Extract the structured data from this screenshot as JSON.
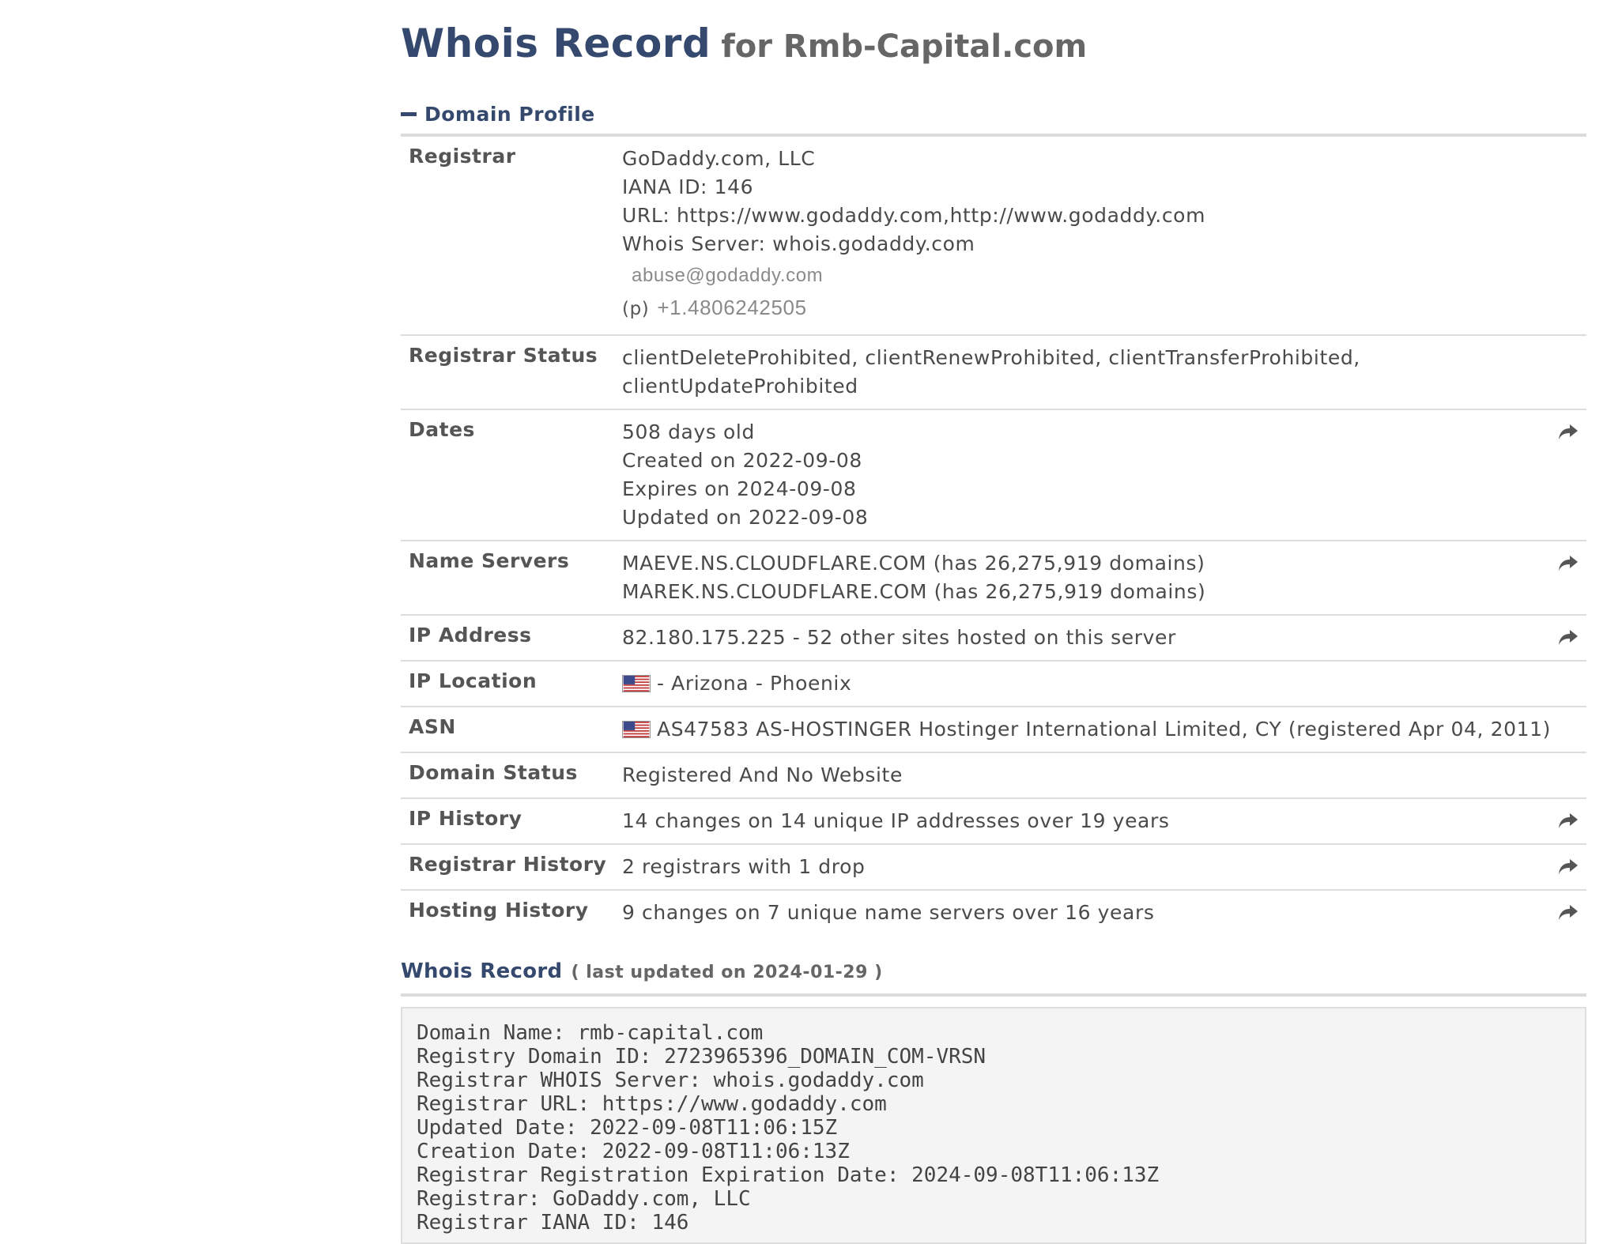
{
  "header": {
    "title_main": "Whois Record",
    "title_sub": "for Rmb-Capital.com"
  },
  "domain_profile": {
    "section_label": "Domain Profile",
    "registrar": {
      "label": "Registrar",
      "name": "GoDaddy.com, LLC",
      "iana": "IANA ID: 146",
      "url": "URL: https://www.godaddy.com,http://www.godaddy.com",
      "whois_server": "Whois Server: whois.godaddy.com",
      "email": "abuse@godaddy.com",
      "phone_prefix": "(p)",
      "phone": "+1.4806242505"
    },
    "registrar_status": {
      "label": "Registrar Status",
      "line1": "clientDeleteProhibited, clientRenewProhibited, clientTransferProhibited,",
      "line2": "clientUpdateProhibited"
    },
    "dates": {
      "label": "Dates",
      "age": "508 days old",
      "created": "Created on 2022-09-08",
      "expires": "Expires on 2024-09-08",
      "updated": "Updated on 2022-09-08"
    },
    "name_servers": {
      "label": "Name Servers",
      "ns1": "MAEVE.NS.CLOUDFLARE.COM (has 26,275,919 domains)",
      "ns2": "MAREK.NS.CLOUDFLARE.COM (has 26,275,919 domains)"
    },
    "ip_address": {
      "label": "IP Address",
      "value": "82.180.175.225 - 52 other sites hosted on this server"
    },
    "ip_location": {
      "label": "IP Location",
      "value": "- Arizona - Phoenix"
    },
    "asn": {
      "label": "ASN",
      "value": "AS47583 AS-HOSTINGER Hostinger International Limited, CY (registered Apr 04, 2011)"
    },
    "domain_status": {
      "label": "Domain Status",
      "value": "Registered And No Website"
    },
    "ip_history": {
      "label": "IP History",
      "value": "14 changes on 14 unique IP addresses over 19 years"
    },
    "registrar_history": {
      "label": "Registrar History",
      "value": "2 registrars with 1 drop"
    },
    "hosting_history": {
      "label": "Hosting History",
      "value": "9 changes on 7 unique name servers over 16 years"
    }
  },
  "whois_record": {
    "title": "Whois Record",
    "updated": "( last updated on 2024-01-29 )",
    "raw_text": "Domain Name: rmb-capital.com\nRegistry Domain ID: 2723965396_DOMAIN_COM-VRSN\nRegistrar WHOIS Server: whois.godaddy.com\nRegistrar URL: https://www.godaddy.com\nUpdated Date: 2022-09-08T11:06:15Z\nCreation Date: 2022-09-08T11:06:13Z\nRegistrar Registration Expiration Date: 2024-09-08T11:06:13Z\nRegistrar: GoDaddy.com, LLC\nRegistrar IANA ID: 146"
  },
  "icons": {
    "share": "share-arrow-icon",
    "flag": "us-flag-icon",
    "collapse": "minus-icon"
  },
  "colors": {
    "accent": "#34496d",
    "divider": "#dddddd",
    "raw_bg": "#f4f4f4"
  }
}
